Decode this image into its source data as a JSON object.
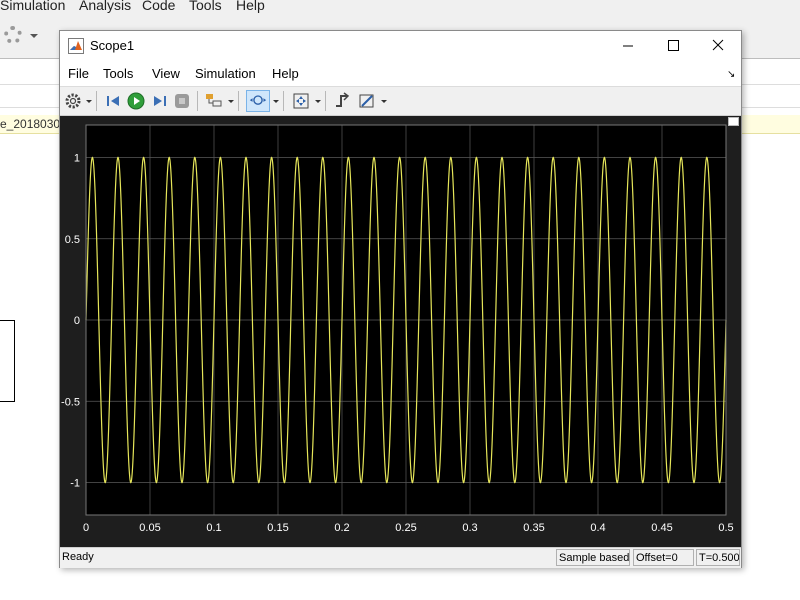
{
  "background_window": {
    "menu": [
      "Simulation",
      "Analysis",
      "Code",
      "Tools",
      "Help"
    ],
    "model_tab": "e_2018030"
  },
  "scope": {
    "title": "Scope1",
    "menu": [
      "File",
      "Tools",
      "View",
      "Simulation",
      "Help"
    ],
    "toolbar": [
      "settings-icon",
      "step-back-icon",
      "run-icon",
      "step-forward-icon",
      "stop-icon",
      "highlight-icon",
      "zoom-x-icon",
      "fit-to-view-icon",
      "triggers-icon",
      "cursor-measurements-icon"
    ],
    "status": {
      "state": "Ready",
      "mode": "Sample based",
      "offset": "Offset=0",
      "time": "T=0.500"
    }
  },
  "colors": {
    "plot_bg": "#000000",
    "frame_bg": "#1e1e1e",
    "signal": "#e6e65a",
    "grid": "#5a5a5a",
    "tick": "#ffffff"
  },
  "chart_data": {
    "type": "line",
    "title": "",
    "xlabel": "",
    "ylabel": "",
    "xlim": [
      0,
      0.5
    ],
    "ylim": [
      -1.2,
      1.2
    ],
    "x_ticks": [
      "0",
      "0.05",
      "0.1",
      "0.15",
      "0.2",
      "0.25",
      "0.3",
      "0.35",
      "0.4",
      "0.45",
      "0.5"
    ],
    "y_ticks": [
      "1",
      "0.5",
      "0",
      "-0.5",
      "-1"
    ],
    "grid": true,
    "series": [
      {
        "function": "sine",
        "amplitude": 1,
        "frequency_hz": 50,
        "phase": 0,
        "x_start": 0,
        "x_end": 0.5
      }
    ]
  }
}
